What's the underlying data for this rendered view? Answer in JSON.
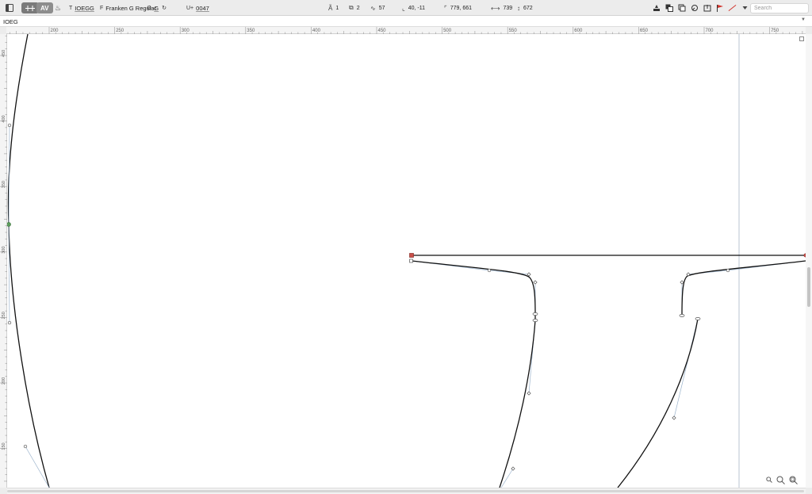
{
  "toolbar": {
    "glyph_label": "IOEGG",
    "font_label": "Franken G Regular",
    "glyph_name": "G",
    "unicode_prefix": "U+",
    "unicode_value": "0047",
    "layers_count": "1",
    "components_count": "2",
    "nodes_count": "57",
    "cursor_coords": "40, -11",
    "selection_coords": "779, 661",
    "width_value": "739",
    "height_value": "672",
    "search_placeholder": "Search",
    "view_mode_label": "AV"
  },
  "text_strip": {
    "value": "IOEG"
  },
  "rulers": {
    "top_labels": [
      "200",
      "250",
      "300",
      "350",
      "400",
      "450",
      "500",
      "550",
      "600",
      "650",
      "700",
      "750"
    ],
    "left_labels": [
      "450",
      "400",
      "350",
      "300",
      "250",
      "200",
      "150"
    ]
  },
  "colors": {
    "outline": "#111111",
    "handle_line": "#8aa9c7",
    "selected_node": "#c9504a",
    "start_node": "#5c9c5c",
    "guide": "#b8c4d2"
  },
  "icons": {
    "sidebar": "sidebar-toggle-icon",
    "flag": "red-flag-icon"
  }
}
